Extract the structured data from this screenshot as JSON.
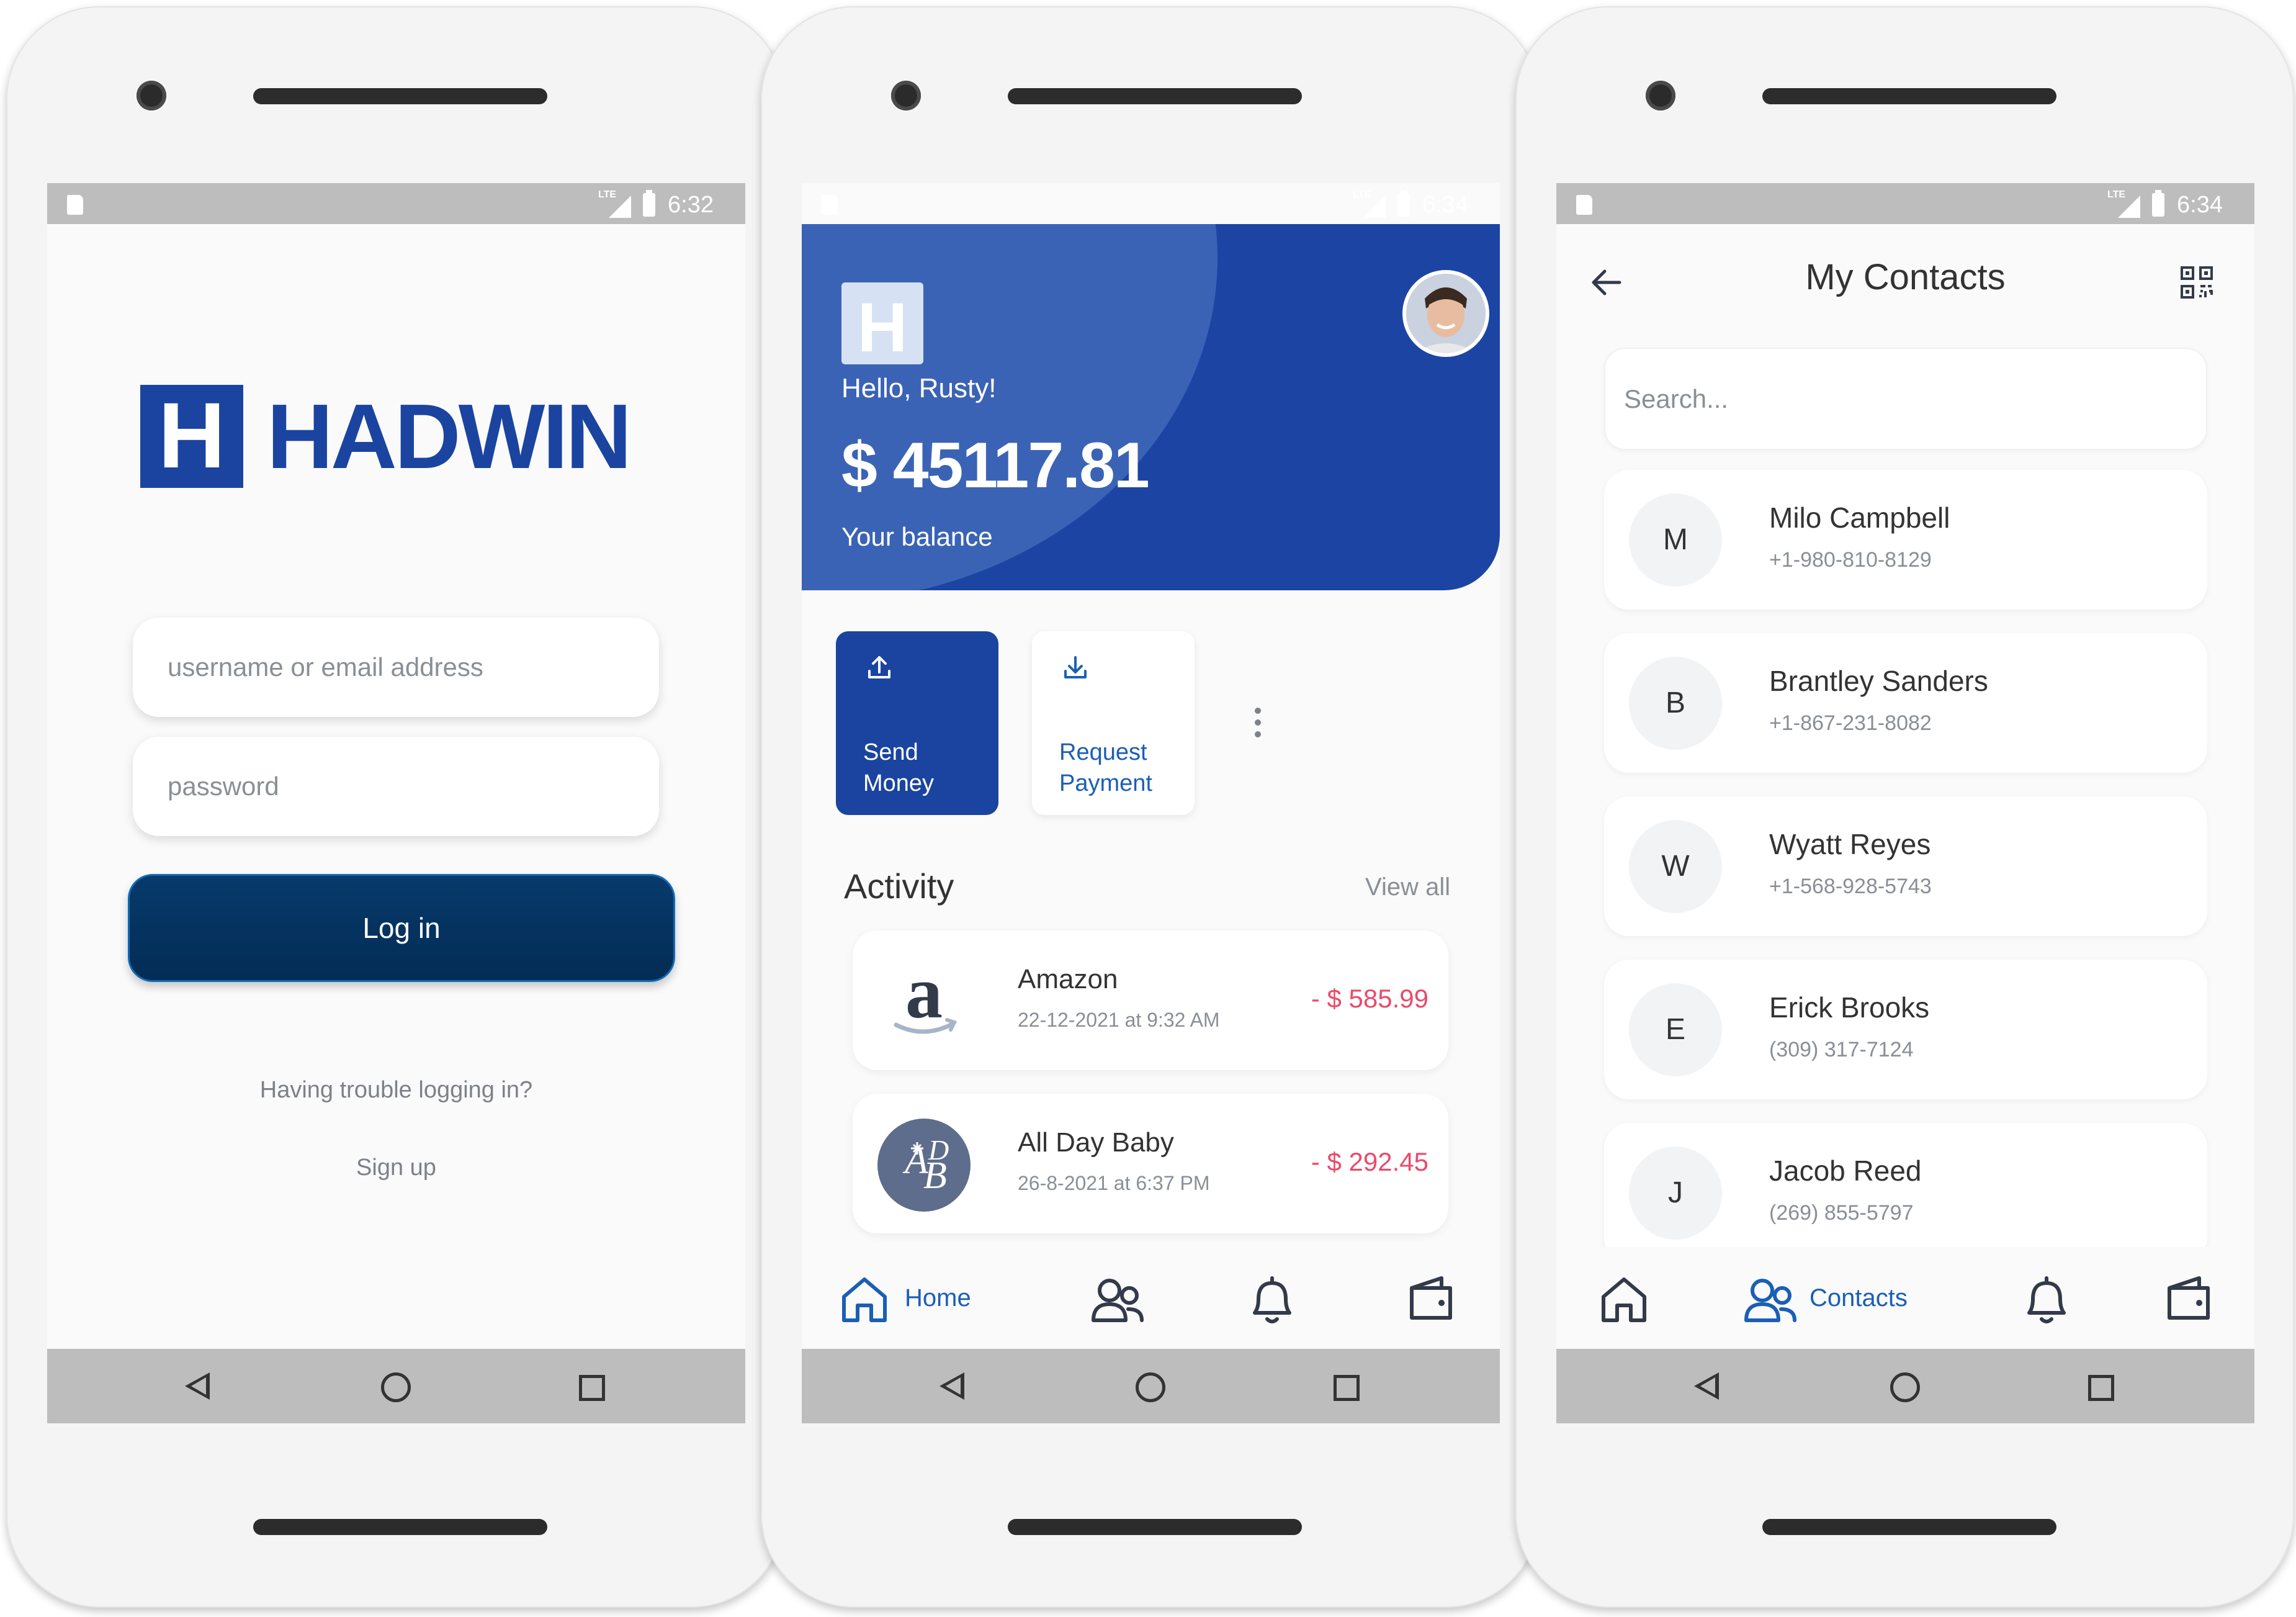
{
  "login_screen": {
    "status_time": "6:32",
    "status_network": "LTE",
    "logo_letter": "H",
    "logo_text": "HADWIN",
    "username_placeholder": "username or email address",
    "password_placeholder": "password",
    "login_label": "Log in",
    "trouble_link": "Having trouble logging in?",
    "signup_link": "Sign up"
  },
  "home_screen": {
    "status_time": "6:34",
    "status_network": "LTE",
    "badge_letter": "H",
    "greeting": "Hello, Rusty!",
    "balance": "$ 45117.81",
    "balance_label": "Your balance",
    "actions": [
      {
        "label_line1": "Send",
        "label_line2": "Money"
      },
      {
        "label_line1": "Request",
        "label_line2": "Payment"
      }
    ],
    "activity_title": "Activity",
    "view_all": "View all",
    "transactions": [
      {
        "name": "Amazon",
        "date": "22-12-2021 at 9:32 AM",
        "amount": "- $ 585.99"
      },
      {
        "name": "All Day Baby",
        "date": "26-8-2021 at 6:37 PM",
        "amount": "- $ 292.45"
      }
    ],
    "active_tab_label": "Home"
  },
  "contacts_screen": {
    "status_time": "6:34",
    "status_network": "LTE",
    "title": "My Contacts",
    "search_placeholder": "Search...",
    "contacts": [
      {
        "initial": "M",
        "name": "Milo Campbell",
        "phone": "+1-980-810-8129"
      },
      {
        "initial": "B",
        "name": "Brantley Sanders",
        "phone": "+1-867-231-8082"
      },
      {
        "initial": "W",
        "name": "Wyatt Reyes",
        "phone": "+1-568-928-5743"
      },
      {
        "initial": "E",
        "name": "Erick Brooks",
        "phone": "(309) 317-7124"
      },
      {
        "initial": "J",
        "name": "Jacob Reed",
        "phone": "(269) 855-5797"
      }
    ],
    "active_tab_label": "Contacts"
  },
  "colors": {
    "brand_blue": "#1a44a0",
    "login_button": "#052f5a",
    "accent_blue": "#1a5fb4",
    "debit_red": "#ea4a6a",
    "status_bar_gray": "#bdbdbd"
  }
}
